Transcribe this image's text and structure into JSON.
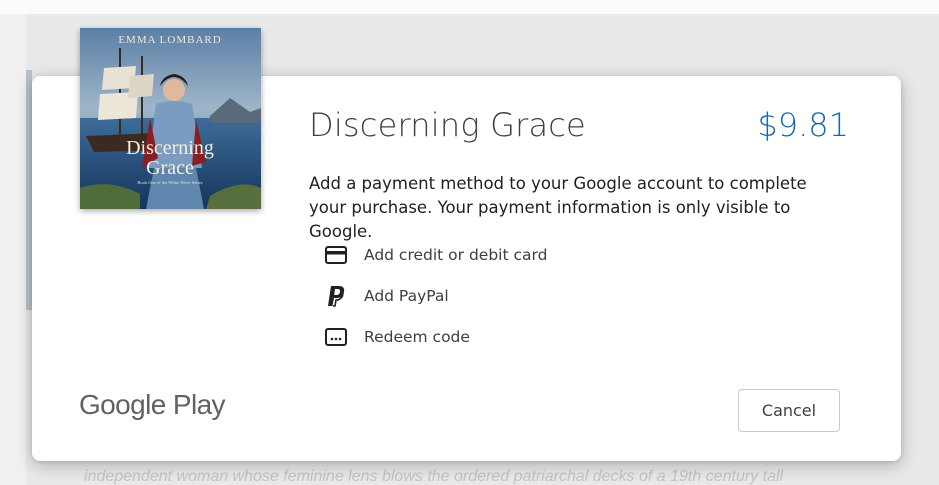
{
  "background": {
    "description_text": "independent woman whose feminine lens blows the ordered patriarchal decks of a 19th century tall"
  },
  "book": {
    "author": "EMMA LOMBARD",
    "cover_title_line1": "Discerning",
    "cover_title_line2": "Grace",
    "cover_series": "Book One of the White Wave Series",
    "title": "Discerning Grace",
    "price": "$9.81"
  },
  "dialog": {
    "message": "Add a payment method to your Google account to complete your purchase. Your payment information is only visible to Google.",
    "options": [
      {
        "label": "Add credit or debit card",
        "icon": "credit-card-icon"
      },
      {
        "label": "Add PayPal",
        "icon": "paypal-icon"
      },
      {
        "label": "Redeem code",
        "icon": "redeem-code-icon"
      }
    ],
    "brand": "Google Play",
    "cancel_label": "Cancel"
  },
  "colors": {
    "price": "#1967a8",
    "text": "#3c4043"
  }
}
